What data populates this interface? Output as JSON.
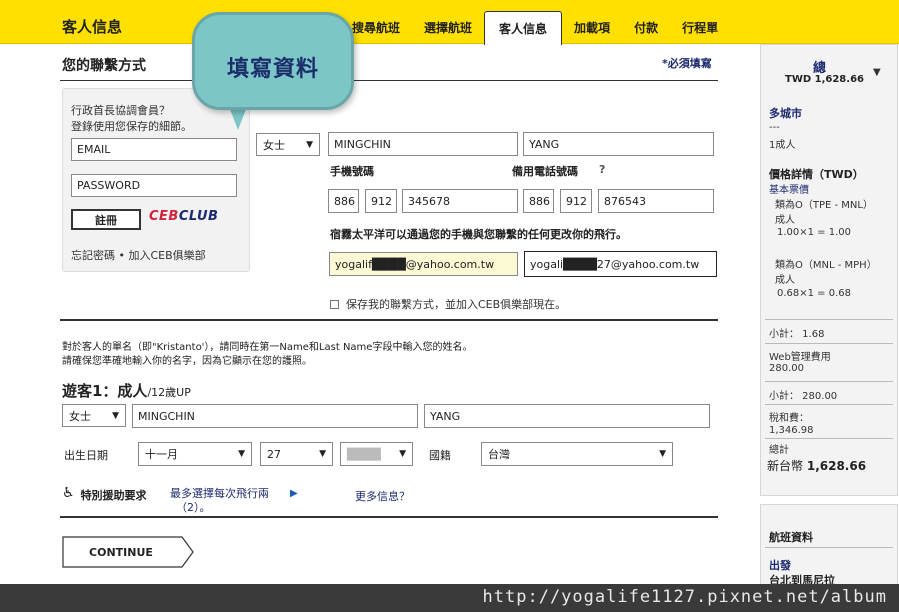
{
  "header": {
    "title": "客人信息",
    "tabs": [
      "搜尋航班",
      "選擇航班",
      "客人信息",
      "加載項",
      "付款",
      "行程單"
    ],
    "active_tab": "客人信息"
  },
  "callout": {
    "text": "填寫資料"
  },
  "contact": {
    "title": "您的聯繫方式",
    "required_note": "*必須填寫",
    "login": {
      "desc_line1": "行政首長協調會員？",
      "desc_line2": "登錄使用您保存的細節。",
      "email": "EMAIL",
      "password": "PASSWORD",
      "login_button": "註冊",
      "brand_ceb": "CEB",
      "brand_club": "CLUB",
      "links": "忘記密碼 • 加入CEB俱樂部"
    },
    "title_select": "女士",
    "first_name": "MINGCHIN",
    "last_name": "YANG",
    "mobile_label": "手機號碼",
    "alt_label": "備用電話號碼",
    "q": "?",
    "mobile": {
      "country": "886",
      "area": "912",
      "number": "345678"
    },
    "alt": {
      "country": "886",
      "area": "912",
      "number": "876543"
    },
    "notice": "宿霧太平洋可以通過您的手機與您聯繫的任何更改你的飛行。",
    "email1": "yogalif████@yahoo.com.tw",
    "email2": "yogali████27@yahoo.com.tw",
    "save_checkbox": "保存我的聯繫方式，並加入CEB俱樂部現在。"
  },
  "passenger_section": {
    "para1": "對於客人的單名（即\"Kristanto'），請同時在第一Name和Last Name字段中輸入您的姓名。",
    "para2": "請確保您準確地輸入你的名字，因為它顯示在您的護照。",
    "passenger_title": "遊客1：成人",
    "age_note": "/12歲UP",
    "title_select": "女士",
    "first_name": "MINGCHIN",
    "last_name": "YANG",
    "dob_label": "出生日期",
    "dob_month": "十一月",
    "dob_day": "27",
    "dob_year": "████",
    "nationality_label": "國籍",
    "nationality": "台灣",
    "assist_title": "特別援助要求",
    "assist_link_line1": "最多選擇每次飛行兩",
    "assist_link_line2": "（2）。",
    "more_info": "更多信息？",
    "continue": "CONTINUE"
  },
  "sidebar": {
    "total_label": "總",
    "total_value": "TWD 1,628.66",
    "trip_type": "多城市",
    "dash": "---",
    "pax": "1成人",
    "price_title": "價格詳情（TWD）",
    "base_fare": "基本票價",
    "seg1_route": "類為O（TPE - MNL）",
    "seg1_pax": "成人",
    "seg1_calc": "1.00×1 = 1.00",
    "seg2_route": "類為O（MNL - MPH）",
    "seg2_pax": "成人",
    "seg2_calc": "0.68×1 = 0.68",
    "subtotal1": "小計： 1.68",
    "web_fee_label": "Web管理費用",
    "web_fee": "280.00",
    "subtotal2": "小計： 280.00",
    "tax_label": "稅和費：",
    "tax": "1,346.98",
    "grand_label": "總計",
    "grand_currency": "新台幣",
    "grand_value": "1,628.66",
    "flight_info": "航班資料",
    "depart_label": "出發",
    "route": "台北到馬尼拉"
  },
  "watermark": "http://yogalife1127.pixnet.net/album"
}
